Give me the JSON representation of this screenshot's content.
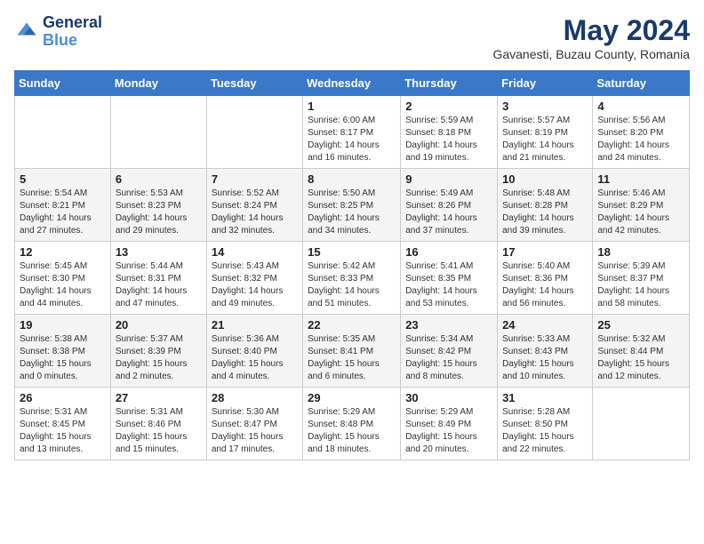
{
  "header": {
    "logo_line1": "General",
    "logo_line2": "Blue",
    "title": "May 2024",
    "subtitle": "Gavanesti, Buzau County, Romania"
  },
  "days_of_week": [
    "Sunday",
    "Monday",
    "Tuesday",
    "Wednesday",
    "Thursday",
    "Friday",
    "Saturday"
  ],
  "weeks": [
    [
      {
        "day": "",
        "info": ""
      },
      {
        "day": "",
        "info": ""
      },
      {
        "day": "",
        "info": ""
      },
      {
        "day": "1",
        "info": "Sunrise: 6:00 AM\nSunset: 8:17 PM\nDaylight: 14 hours\nand 16 minutes."
      },
      {
        "day": "2",
        "info": "Sunrise: 5:59 AM\nSunset: 8:18 PM\nDaylight: 14 hours\nand 19 minutes."
      },
      {
        "day": "3",
        "info": "Sunrise: 5:57 AM\nSunset: 8:19 PM\nDaylight: 14 hours\nand 21 minutes."
      },
      {
        "day": "4",
        "info": "Sunrise: 5:56 AM\nSunset: 8:20 PM\nDaylight: 14 hours\nand 24 minutes."
      }
    ],
    [
      {
        "day": "5",
        "info": "Sunrise: 5:54 AM\nSunset: 8:21 PM\nDaylight: 14 hours\nand 27 minutes."
      },
      {
        "day": "6",
        "info": "Sunrise: 5:53 AM\nSunset: 8:23 PM\nDaylight: 14 hours\nand 29 minutes."
      },
      {
        "day": "7",
        "info": "Sunrise: 5:52 AM\nSunset: 8:24 PM\nDaylight: 14 hours\nand 32 minutes."
      },
      {
        "day": "8",
        "info": "Sunrise: 5:50 AM\nSunset: 8:25 PM\nDaylight: 14 hours\nand 34 minutes."
      },
      {
        "day": "9",
        "info": "Sunrise: 5:49 AM\nSunset: 8:26 PM\nDaylight: 14 hours\nand 37 minutes."
      },
      {
        "day": "10",
        "info": "Sunrise: 5:48 AM\nSunset: 8:28 PM\nDaylight: 14 hours\nand 39 minutes."
      },
      {
        "day": "11",
        "info": "Sunrise: 5:46 AM\nSunset: 8:29 PM\nDaylight: 14 hours\nand 42 minutes."
      }
    ],
    [
      {
        "day": "12",
        "info": "Sunrise: 5:45 AM\nSunset: 8:30 PM\nDaylight: 14 hours\nand 44 minutes."
      },
      {
        "day": "13",
        "info": "Sunrise: 5:44 AM\nSunset: 8:31 PM\nDaylight: 14 hours\nand 47 minutes."
      },
      {
        "day": "14",
        "info": "Sunrise: 5:43 AM\nSunset: 8:32 PM\nDaylight: 14 hours\nand 49 minutes."
      },
      {
        "day": "15",
        "info": "Sunrise: 5:42 AM\nSunset: 8:33 PM\nDaylight: 14 hours\nand 51 minutes."
      },
      {
        "day": "16",
        "info": "Sunrise: 5:41 AM\nSunset: 8:35 PM\nDaylight: 14 hours\nand 53 minutes."
      },
      {
        "day": "17",
        "info": "Sunrise: 5:40 AM\nSunset: 8:36 PM\nDaylight: 14 hours\nand 56 minutes."
      },
      {
        "day": "18",
        "info": "Sunrise: 5:39 AM\nSunset: 8:37 PM\nDaylight: 14 hours\nand 58 minutes."
      }
    ],
    [
      {
        "day": "19",
        "info": "Sunrise: 5:38 AM\nSunset: 8:38 PM\nDaylight: 15 hours\nand 0 minutes."
      },
      {
        "day": "20",
        "info": "Sunrise: 5:37 AM\nSunset: 8:39 PM\nDaylight: 15 hours\nand 2 minutes."
      },
      {
        "day": "21",
        "info": "Sunrise: 5:36 AM\nSunset: 8:40 PM\nDaylight: 15 hours\nand 4 minutes."
      },
      {
        "day": "22",
        "info": "Sunrise: 5:35 AM\nSunset: 8:41 PM\nDaylight: 15 hours\nand 6 minutes."
      },
      {
        "day": "23",
        "info": "Sunrise: 5:34 AM\nSunset: 8:42 PM\nDaylight: 15 hours\nand 8 minutes."
      },
      {
        "day": "24",
        "info": "Sunrise: 5:33 AM\nSunset: 8:43 PM\nDaylight: 15 hours\nand 10 minutes."
      },
      {
        "day": "25",
        "info": "Sunrise: 5:32 AM\nSunset: 8:44 PM\nDaylight: 15 hours\nand 12 minutes."
      }
    ],
    [
      {
        "day": "26",
        "info": "Sunrise: 5:31 AM\nSunset: 8:45 PM\nDaylight: 15 hours\nand 13 minutes."
      },
      {
        "day": "27",
        "info": "Sunrise: 5:31 AM\nSunset: 8:46 PM\nDaylight: 15 hours\nand 15 minutes."
      },
      {
        "day": "28",
        "info": "Sunrise: 5:30 AM\nSunset: 8:47 PM\nDaylight: 15 hours\nand 17 minutes."
      },
      {
        "day": "29",
        "info": "Sunrise: 5:29 AM\nSunset: 8:48 PM\nDaylight: 15 hours\nand 18 minutes."
      },
      {
        "day": "30",
        "info": "Sunrise: 5:29 AM\nSunset: 8:49 PM\nDaylight: 15 hours\nand 20 minutes."
      },
      {
        "day": "31",
        "info": "Sunrise: 5:28 AM\nSunset: 8:50 PM\nDaylight: 15 hours\nand 22 minutes."
      },
      {
        "day": "",
        "info": ""
      }
    ]
  ]
}
